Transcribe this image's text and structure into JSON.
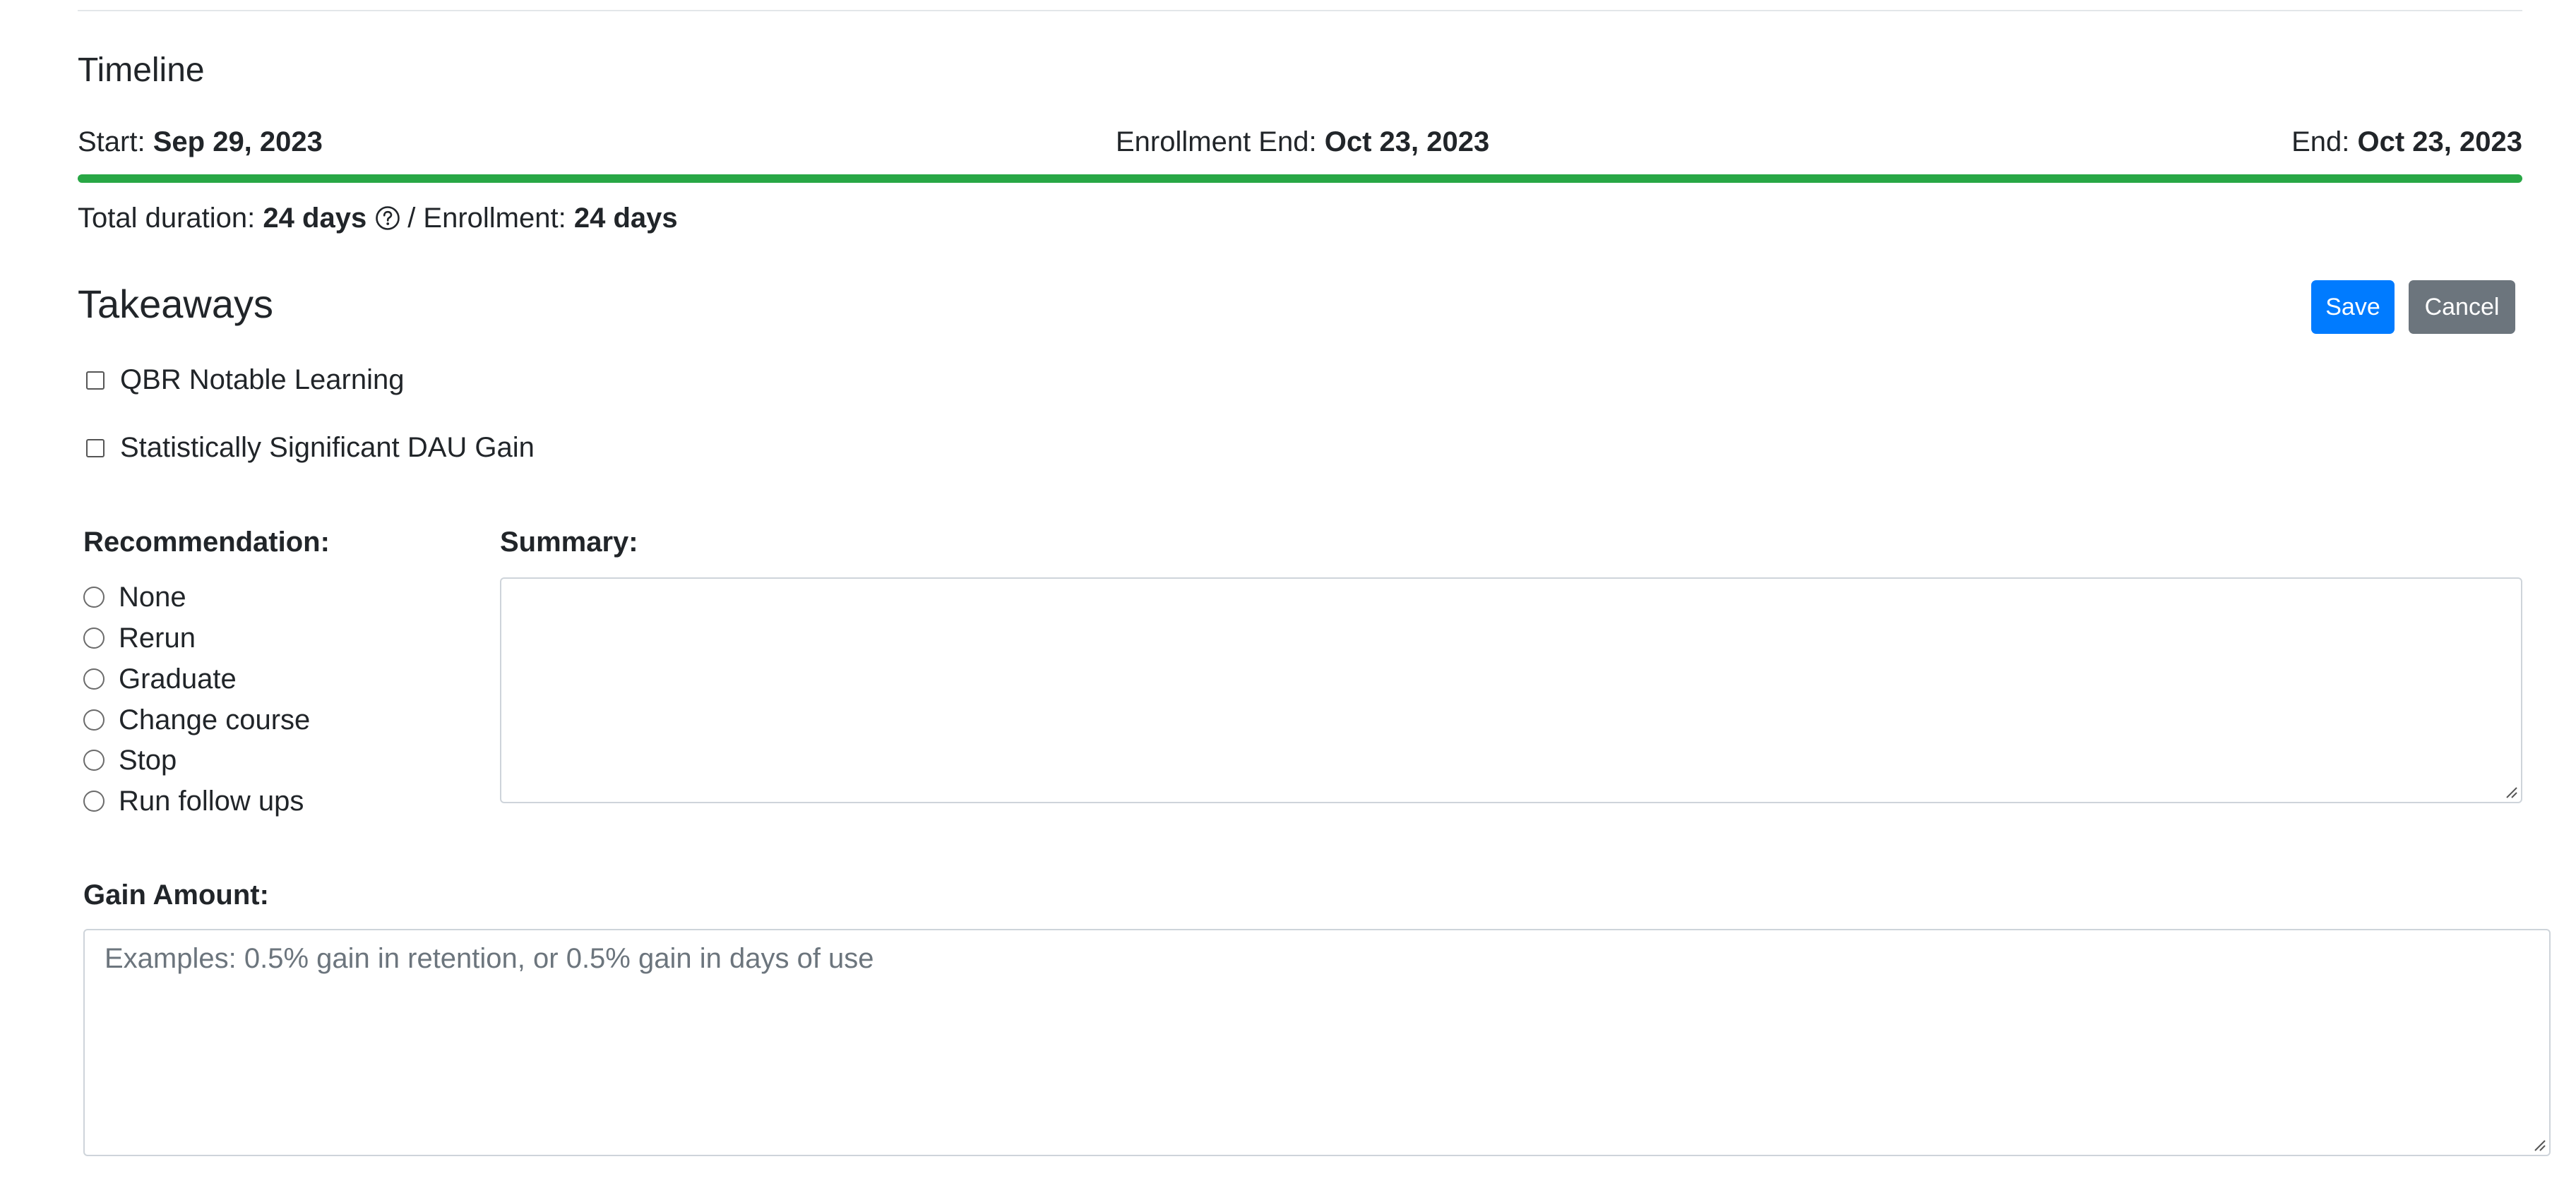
{
  "timeline": {
    "title": "Timeline",
    "start_label": "Start:",
    "start_date": "Sep 29, 2023",
    "enrollment_end_label": "Enrollment End:",
    "enrollment_end_date": "Oct 23, 2023",
    "end_label": "End:",
    "end_date": "Oct 23, 2023",
    "progress_percent": 100,
    "progress_color": "#28a745",
    "total_duration_label": "Total duration:",
    "total_duration_value": "24 days",
    "enrollment_label": "/ Enrollment:",
    "enrollment_value": "24 days"
  },
  "takeaways": {
    "title": "Takeaways",
    "save_label": "Save",
    "cancel_label": "Cancel",
    "save_color": "#007bff",
    "cancel_color": "#6c757d",
    "checkboxes": [
      {
        "label": "QBR Notable Learning",
        "checked": false
      },
      {
        "label": "Statistically Significant DAU Gain",
        "checked": false
      }
    ],
    "recommendation_label": "Recommendation:",
    "recommendation_options": [
      {
        "label": "None",
        "selected": false
      },
      {
        "label": "Rerun",
        "selected": false
      },
      {
        "label": "Graduate",
        "selected": false
      },
      {
        "label": "Change course",
        "selected": false
      },
      {
        "label": "Stop",
        "selected": false
      },
      {
        "label": "Run follow ups",
        "selected": false
      }
    ],
    "summary_label": "Summary:",
    "summary_value": "",
    "gain_amount_label": "Gain Amount:",
    "gain_amount_value": "",
    "gain_amount_placeholder": "Examples: 0.5% gain in retention, or 0.5% gain in days of use"
  }
}
